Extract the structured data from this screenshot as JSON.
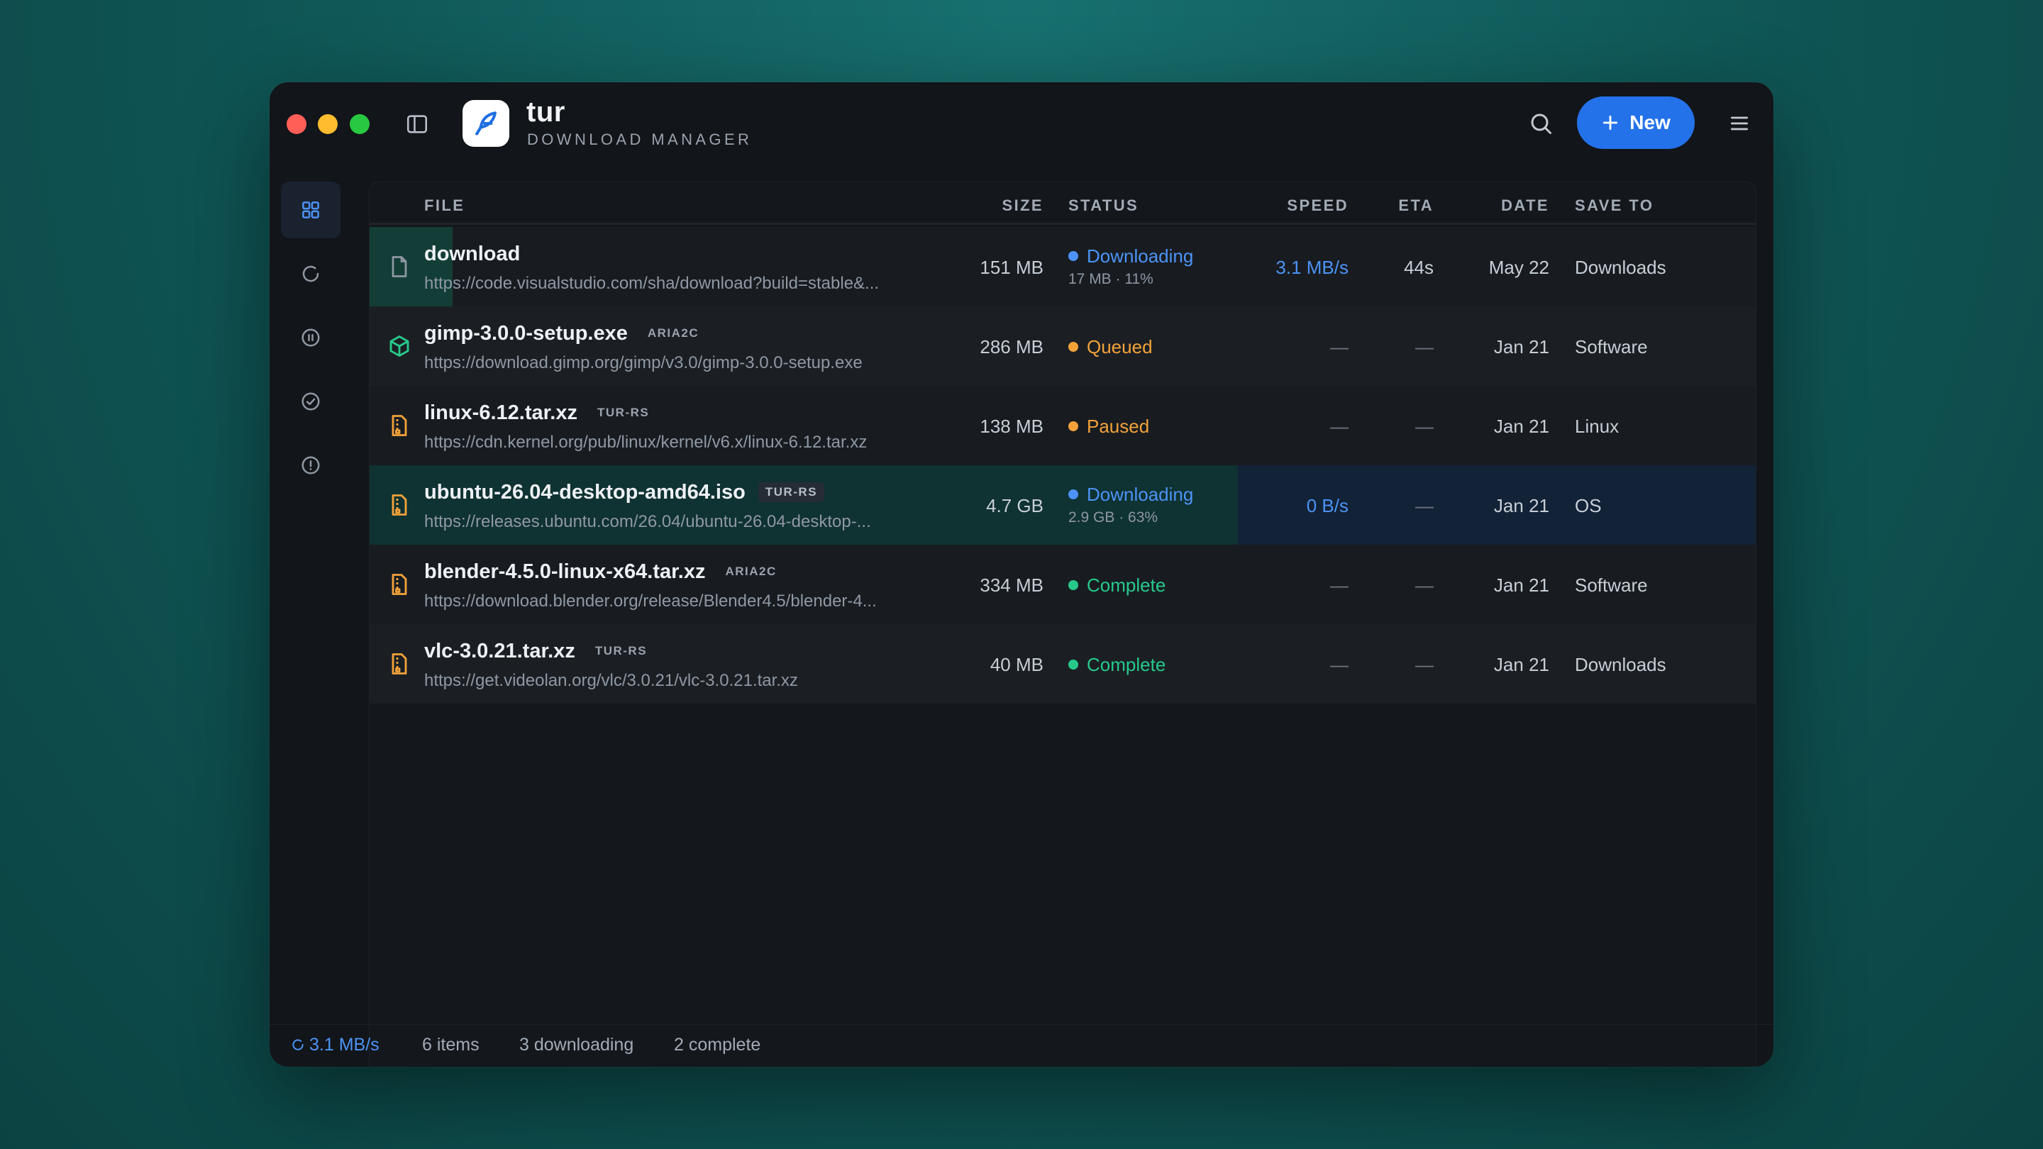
{
  "app": {
    "name": "tur",
    "subtitle": "DOWNLOAD MANAGER",
    "accent_color": "#2472ea",
    "new_button_label": "New"
  },
  "icons": {
    "search": "search-icon",
    "menu": "hamburger-menu-icon",
    "sidebar_toggle": "sidebar-toggle-icon",
    "new": "plus-icon",
    "logo": "feather-icon"
  },
  "sidenav": [
    {
      "name": "all",
      "icon": "grid-icon",
      "active": true
    },
    {
      "name": "downloading",
      "icon": "spinner-icon",
      "active": false
    },
    {
      "name": "paused",
      "icon": "pause-circle-icon",
      "active": false
    },
    {
      "name": "completed",
      "icon": "check-circle-icon",
      "active": false
    },
    {
      "name": "errors",
      "icon": "alert-circle-icon",
      "active": false
    }
  ],
  "table": {
    "headers": {
      "file": "FILE",
      "size": "SIZE",
      "status": "STATUS",
      "speed": "SPEED",
      "eta": "ETA",
      "date": "DATE",
      "save_to": "SAVE TO"
    },
    "rows": [
      {
        "name": "download",
        "tag": "",
        "url": "https://code.visualstudio.com/sha/download?build=stable&...",
        "size": "151 MB",
        "status": "Downloading",
        "status_color": "#4c93f5",
        "status_sub": "17 MB · 11%",
        "progress": 0.11,
        "speed": "3.1 MB/s",
        "eta": "44s",
        "date": "May 22",
        "save_to": "Downloads",
        "icon": "file-icon"
      },
      {
        "name": "gimp-3.0.0-setup.exe",
        "tag": "ARIA2C",
        "url": "https://download.gimp.org/gimp/v3.0/gimp-3.0.0-setup.exe",
        "size": "286 MB",
        "status": "Queued",
        "status_color": "#f3a23a",
        "status_sub": "",
        "speed": "—",
        "eta": "—",
        "date": "Jan 21",
        "save_to": "Software",
        "icon": "package-icon"
      },
      {
        "name": "linux-6.12.tar.xz",
        "tag": "TUR-RS",
        "url": "https://cdn.kernel.org/pub/linux/kernel/v6.x/linux-6.12.tar.xz",
        "size": "138 MB",
        "status": "Paused",
        "status_color": "#f3a23a",
        "status_sub": "",
        "speed": "—",
        "eta": "—",
        "date": "Jan 21",
        "save_to": "Linux",
        "icon": "archive-icon"
      },
      {
        "name": "ubuntu-26.04-desktop-amd64.iso",
        "tag": "TUR-RS",
        "url": "https://releases.ubuntu.com/26.04/ubuntu-26.04-desktop-...",
        "size": "4.7 GB",
        "status": "Downloading",
        "status_color": "#4c93f5",
        "status_sub": "2.9 GB · 63%",
        "progress": 0.63,
        "speed": "0 B/s",
        "eta": "—",
        "date": "Jan 21",
        "save_to": "OS",
        "icon": "archive-icon"
      },
      {
        "name": "blender-4.5.0-linux-x64.tar.xz",
        "tag": "ARIA2C",
        "url": "https://download.blender.org/release/Blender4.5/blender-4...",
        "size": "334 MB",
        "status": "Complete",
        "status_color": "#27c98b",
        "status_sub": "",
        "speed": "—",
        "eta": "—",
        "date": "Jan 21",
        "save_to": "Software",
        "icon": "archive-icon"
      },
      {
        "name": "vlc-3.0.21.tar.xz",
        "tag": "TUR-RS",
        "url": "https://get.videolan.org/vlc/3.0.21/vlc-3.0.21.tar.xz",
        "size": "40 MB",
        "status": "Complete",
        "status_color": "#27c98b",
        "status_sub": "",
        "speed": "—",
        "eta": "—",
        "date": "Jan 21",
        "save_to": "Downloads",
        "icon": "archive-icon"
      }
    ]
  },
  "statusbar": {
    "speed": "3.1 MB/s",
    "items": "6 items",
    "downloading": "3 downloading",
    "complete": "2 complete"
  }
}
